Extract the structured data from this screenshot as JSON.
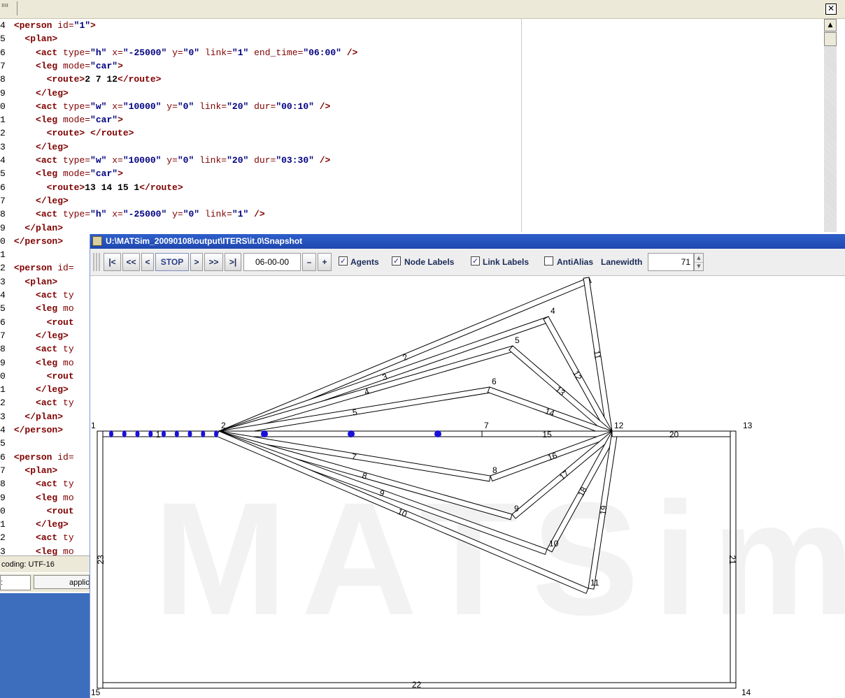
{
  "editor": {
    "topbar_text": "ıııı",
    "close_glyph": "✕",
    "scroll_up": "▲",
    "lines": [
      {
        "no": "4",
        "indent": 0,
        "tokens": [
          [
            "tag",
            "<person"
          ],
          [
            "attr",
            " id="
          ],
          [
            "val",
            "\"1\""
          ],
          [
            "tag",
            ">"
          ]
        ]
      },
      {
        "no": "5",
        "indent": 2,
        "tokens": [
          [
            "tag",
            "<plan>"
          ]
        ]
      },
      {
        "no": "6",
        "indent": 4,
        "tokens": [
          [
            "tag",
            "<act"
          ],
          [
            "attr",
            " type="
          ],
          [
            "val",
            "\"h\""
          ],
          [
            "attr",
            " x="
          ],
          [
            "val",
            "\"-25000\""
          ],
          [
            "attr",
            " y="
          ],
          [
            "val",
            "\"0\""
          ],
          [
            "attr",
            " link="
          ],
          [
            "val",
            "\"1\""
          ],
          [
            "attr",
            " end_time="
          ],
          [
            "val",
            "\"06:00\""
          ],
          [
            "tag",
            " />"
          ]
        ]
      },
      {
        "no": "7",
        "indent": 4,
        "tokens": [
          [
            "tag",
            "<leg"
          ],
          [
            "attr",
            " mode="
          ],
          [
            "val",
            "\"car\""
          ],
          [
            "tag",
            ">"
          ]
        ]
      },
      {
        "no": "8",
        "indent": 6,
        "tokens": [
          [
            "tag",
            "<route>"
          ],
          [
            "txt",
            "2 7 12"
          ],
          [
            "tag",
            "</route>"
          ]
        ]
      },
      {
        "no": "9",
        "indent": 4,
        "tokens": [
          [
            "tag",
            "</leg>"
          ]
        ]
      },
      {
        "no": "0",
        "indent": 4,
        "tokens": [
          [
            "tag",
            "<act"
          ],
          [
            "attr",
            " type="
          ],
          [
            "val",
            "\"w\""
          ],
          [
            "attr",
            " x="
          ],
          [
            "val",
            "\"10000\""
          ],
          [
            "attr",
            " y="
          ],
          [
            "val",
            "\"0\""
          ],
          [
            "attr",
            " link="
          ],
          [
            "val",
            "\"20\""
          ],
          [
            "attr",
            " dur="
          ],
          [
            "val",
            "\"00:10\""
          ],
          [
            "tag",
            " />"
          ]
        ]
      },
      {
        "no": "1",
        "indent": 4,
        "tokens": [
          [
            "tag",
            "<leg"
          ],
          [
            "attr",
            " mode="
          ],
          [
            "val",
            "\"car\""
          ],
          [
            "tag",
            ">"
          ]
        ]
      },
      {
        "no": "2",
        "indent": 6,
        "tokens": [
          [
            "tag",
            "<route>"
          ],
          [
            "txt",
            " "
          ],
          [
            "tag",
            "</route>"
          ]
        ]
      },
      {
        "no": "3",
        "indent": 4,
        "tokens": [
          [
            "tag",
            "</leg>"
          ]
        ]
      },
      {
        "no": "4",
        "indent": 4,
        "tokens": [
          [
            "tag",
            "<act"
          ],
          [
            "attr",
            " type="
          ],
          [
            "val",
            "\"w\""
          ],
          [
            "attr",
            " x="
          ],
          [
            "val",
            "\"10000\""
          ],
          [
            "attr",
            " y="
          ],
          [
            "val",
            "\"0\""
          ],
          [
            "attr",
            " link="
          ],
          [
            "val",
            "\"20\""
          ],
          [
            "attr",
            " dur="
          ],
          [
            "val",
            "\"03:30\""
          ],
          [
            "tag",
            " />"
          ]
        ]
      },
      {
        "no": "5",
        "indent": 4,
        "tokens": [
          [
            "tag",
            "<leg"
          ],
          [
            "attr",
            " mode="
          ],
          [
            "val",
            "\"car\""
          ],
          [
            "tag",
            ">"
          ]
        ]
      },
      {
        "no": "6",
        "indent": 6,
        "tokens": [
          [
            "tag",
            "<route>"
          ],
          [
            "txt",
            "13 14 15 1"
          ],
          [
            "tag",
            "</route>"
          ]
        ]
      },
      {
        "no": "7",
        "indent": 4,
        "tokens": [
          [
            "tag",
            "</leg>"
          ]
        ]
      },
      {
        "no": "8",
        "indent": 4,
        "tokens": [
          [
            "tag",
            "<act"
          ],
          [
            "attr",
            " type="
          ],
          [
            "val",
            "\"h\""
          ],
          [
            "attr",
            " x="
          ],
          [
            "val",
            "\"-25000\""
          ],
          [
            "attr",
            " y="
          ],
          [
            "val",
            "\"0\""
          ],
          [
            "attr",
            " link="
          ],
          [
            "val",
            "\"1\""
          ],
          [
            "tag",
            " />"
          ]
        ]
      },
      {
        "no": "9",
        "indent": 2,
        "tokens": [
          [
            "tag",
            "</plan>"
          ]
        ]
      },
      {
        "no": "0",
        "indent": 0,
        "tokens": [
          [
            "tag",
            "</person>"
          ]
        ]
      },
      {
        "no": "1",
        "indent": 0,
        "tokens": []
      },
      {
        "no": "2",
        "indent": 0,
        "tokens": [
          [
            "tag",
            "<person"
          ],
          [
            "attr",
            " id="
          ]
        ]
      },
      {
        "no": "3",
        "indent": 2,
        "tokens": [
          [
            "tag",
            "<plan>"
          ]
        ]
      },
      {
        "no": "4",
        "indent": 4,
        "tokens": [
          [
            "tag",
            "<act"
          ],
          [
            "attr",
            " ty"
          ]
        ]
      },
      {
        "no": "5",
        "indent": 4,
        "tokens": [
          [
            "tag",
            "<leg"
          ],
          [
            "attr",
            " mo"
          ]
        ]
      },
      {
        "no": "6",
        "indent": 6,
        "tokens": [
          [
            "tag",
            "<rout"
          ]
        ]
      },
      {
        "no": "7",
        "indent": 4,
        "tokens": [
          [
            "tag",
            "</leg>"
          ]
        ]
      },
      {
        "no": "8",
        "indent": 4,
        "tokens": [
          [
            "tag",
            "<act"
          ],
          [
            "attr",
            " ty"
          ]
        ]
      },
      {
        "no": "9",
        "indent": 4,
        "tokens": [
          [
            "tag",
            "<leg"
          ],
          [
            "attr",
            " mo"
          ]
        ]
      },
      {
        "no": "0",
        "indent": 6,
        "tokens": [
          [
            "tag",
            "<rout"
          ]
        ]
      },
      {
        "no": "1",
        "indent": 4,
        "tokens": [
          [
            "tag",
            "</leg>"
          ]
        ]
      },
      {
        "no": "2",
        "indent": 4,
        "tokens": [
          [
            "tag",
            "<act"
          ],
          [
            "attr",
            " ty"
          ]
        ]
      },
      {
        "no": "3",
        "indent": 2,
        "tokens": [
          [
            "tag",
            "</plan>"
          ]
        ]
      },
      {
        "no": "4",
        "indent": 0,
        "tokens": [
          [
            "tag",
            "</person>"
          ]
        ]
      },
      {
        "no": "5",
        "indent": 0,
        "tokens": []
      },
      {
        "no": "6",
        "indent": 0,
        "tokens": [
          [
            "tag",
            "<person"
          ],
          [
            "attr",
            " id="
          ]
        ]
      },
      {
        "no": "7",
        "indent": 2,
        "tokens": [
          [
            "tag",
            "<plan>"
          ]
        ]
      },
      {
        "no": "8",
        "indent": 4,
        "tokens": [
          [
            "tag",
            "<act"
          ],
          [
            "attr",
            " ty"
          ]
        ]
      },
      {
        "no": "9",
        "indent": 4,
        "tokens": [
          [
            "tag",
            "<leg"
          ],
          [
            "attr",
            " mo"
          ]
        ]
      },
      {
        "no": "0",
        "indent": 6,
        "tokens": [
          [
            "tag",
            "<rout"
          ]
        ]
      },
      {
        "no": "1",
        "indent": 4,
        "tokens": [
          [
            "tag",
            "</leg>"
          ]
        ]
      },
      {
        "no": "2",
        "indent": 4,
        "tokens": [
          [
            "tag",
            "<act"
          ],
          [
            "attr",
            " ty"
          ]
        ]
      },
      {
        "no": "3",
        "indent": 4,
        "tokens": [
          [
            "tag",
            "<leg"
          ],
          [
            "attr",
            " mo"
          ]
        ]
      }
    ],
    "encoding_text": "coding: UTF-16",
    "tab_left": ":",
    "tab_app": "applicat"
  },
  "snapshot": {
    "title": "U:\\MATSim_20090108\\output\\ITERS\\it.0\\Snapshot",
    "toolbar": {
      "btn_first": "|<",
      "btn_rewind": "<<",
      "btn_back": "<",
      "btn_stop": "STOP",
      "btn_fwd": ">",
      "btn_ffwd": ">>",
      "btn_last": ">|",
      "time": "06-00-00",
      "btn_minus": "–",
      "btn_plus": "+",
      "agents_label": "Agents",
      "agents_checked": true,
      "node_labels_label": "Node Labels",
      "node_labels_checked": true,
      "link_labels_label": "Link Labels",
      "link_labels_checked": true,
      "antialias_label": "AntiAlias",
      "antialias_checked": false,
      "lanewidth_label": "Lanewidth",
      "lanewidth_value": "71",
      "check_glyph": "✓",
      "spin_up": "▲",
      "spin_down": "▼"
    },
    "watermark": "MATSim",
    "network": {
      "nodes": [
        {
          "id": "1",
          "label": "1"
        },
        {
          "id": "2",
          "label": "2"
        },
        {
          "id": "3",
          "label": "3"
        },
        {
          "id": "4",
          "label": "4"
        },
        {
          "id": "5",
          "label": "5"
        },
        {
          "id": "6",
          "label": "6"
        },
        {
          "id": "7",
          "label": "7"
        },
        {
          "id": "8",
          "label": "8"
        },
        {
          "id": "9",
          "label": "9"
        },
        {
          "id": "10",
          "label": "10"
        },
        {
          "id": "11",
          "label": "11"
        },
        {
          "id": "12",
          "label": "12"
        },
        {
          "id": "13",
          "label": "13"
        },
        {
          "id": "14",
          "label": "14"
        },
        {
          "id": "15",
          "label": "15"
        }
      ],
      "links": [
        {
          "id": "1",
          "from": "1",
          "to": "2"
        },
        {
          "id": "2",
          "from": "2",
          "to": "3"
        },
        {
          "id": "3",
          "from": "2",
          "to": "4"
        },
        {
          "id": "4",
          "from": "2",
          "to": "5"
        },
        {
          "id": "5",
          "from": "2",
          "to": "6"
        },
        {
          "id": "6",
          "from": "2",
          "to": "7"
        },
        {
          "id": "7",
          "from": "2",
          "to": "8"
        },
        {
          "id": "8",
          "from": "2",
          "to": "9"
        },
        {
          "id": "9",
          "from": "2",
          "to": "10"
        },
        {
          "id": "10",
          "from": "2",
          "to": "11"
        },
        {
          "id": "11",
          "from": "3",
          "to": "12"
        },
        {
          "id": "12",
          "from": "4",
          "to": "12"
        },
        {
          "id": "13",
          "from": "5",
          "to": "12"
        },
        {
          "id": "14",
          "from": "6",
          "to": "12"
        },
        {
          "id": "15",
          "from": "7",
          "to": "12"
        },
        {
          "id": "16",
          "from": "8",
          "to": "12"
        },
        {
          "id": "17",
          "from": "9",
          "to": "12"
        },
        {
          "id": "18",
          "from": "10",
          "to": "12"
        },
        {
          "id": "19",
          "from": "11",
          "to": "12"
        },
        {
          "id": "20",
          "from": "12",
          "to": "13"
        },
        {
          "id": "21",
          "from": "13",
          "to": "14"
        },
        {
          "id": "22",
          "from": "14",
          "to": "15"
        },
        {
          "id": "23",
          "from": "15",
          "to": "1"
        }
      ],
      "agents_on_link_1": 9,
      "agents_on_link_6": 3,
      "agent_color": "#1a10d8"
    }
  }
}
